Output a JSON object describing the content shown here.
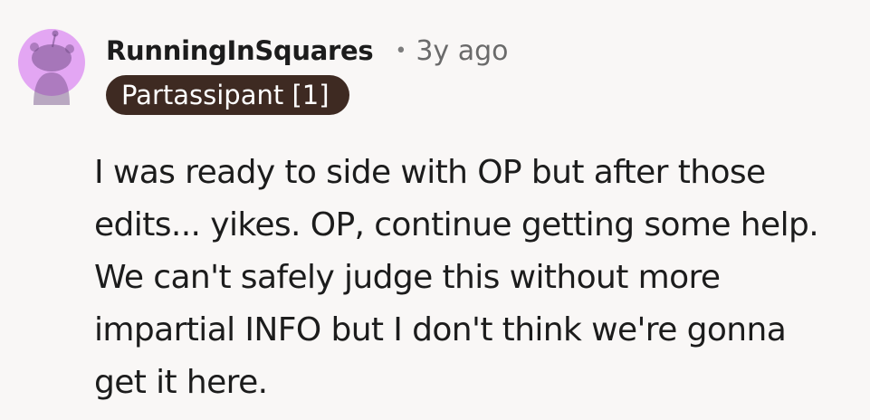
{
  "comment": {
    "author": "RunningInSquares",
    "separator": "•",
    "age": "3y ago",
    "flair": "Partassipant [1]",
    "body_lines": [
      "I was ready to side with OP but after those",
      "edits... yikes. OP, continue getting some help.",
      "We can't safely judge this without more",
      "impartial INFO but I don't think we're gonna",
      "get it here."
    ]
  },
  "colors": {
    "avatar_bg": "#e3a6f3",
    "flair_bg": "#3e2a22",
    "text": "#1c1c1c"
  },
  "icons": {
    "avatar": "reddit-snoo-avatar-icon"
  }
}
